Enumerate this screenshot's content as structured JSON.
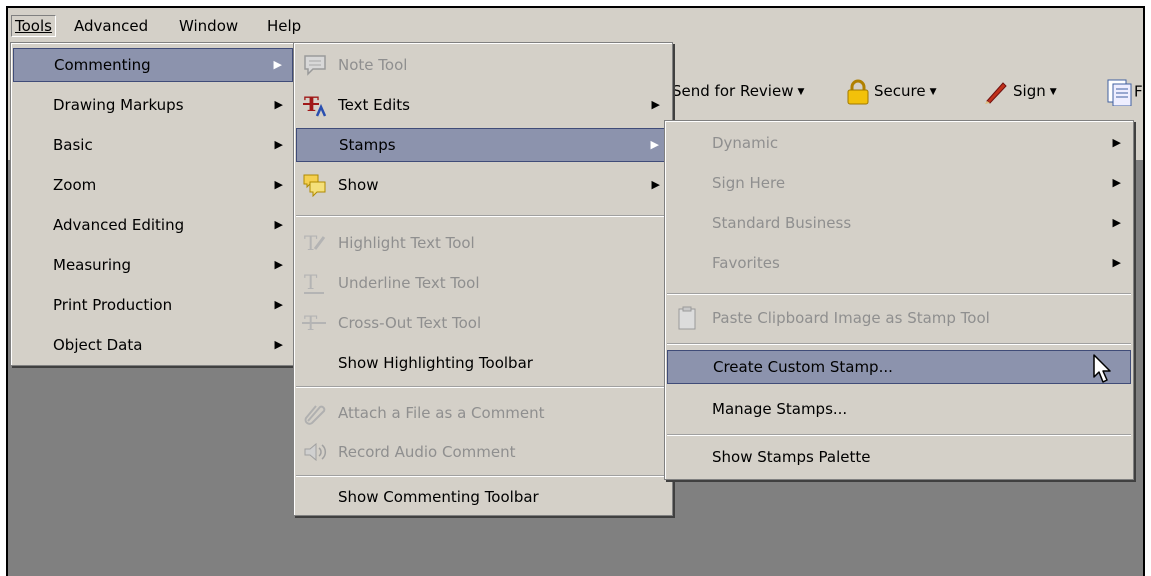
{
  "menubar": {
    "items": [
      {
        "label": "Tools",
        "open": true
      },
      {
        "label": "Advanced"
      },
      {
        "label": "Window"
      },
      {
        "label": "Help"
      }
    ]
  },
  "toolbar": {
    "send_for_review": "Send for Review",
    "secure": "Secure",
    "sign": "Sign",
    "forms_partial": "Fo"
  },
  "tools_menu": {
    "items": [
      {
        "label": "Commenting",
        "submenu": true,
        "highlighted": true
      },
      {
        "label": "Drawing Markups",
        "submenu": true
      },
      {
        "label": "Basic",
        "submenu": true
      },
      {
        "label": "Zoom",
        "submenu": true
      },
      {
        "label": "Advanced Editing",
        "submenu": true
      },
      {
        "label": "Measuring",
        "submenu": true
      },
      {
        "label": "Print Production",
        "submenu": true
      },
      {
        "label": "Object Data",
        "submenu": true
      }
    ]
  },
  "commenting_menu": {
    "items": [
      {
        "label": "Note Tool",
        "disabled": true,
        "icon": "note-icon"
      },
      {
        "label": "Text Edits",
        "submenu": true,
        "icon": "text-edits-icon"
      },
      {
        "label": "Stamps",
        "submenu": true,
        "highlighted": true
      },
      {
        "label": "Show",
        "submenu": true,
        "icon": "show-comments-icon"
      },
      {
        "label": "Highlight Text Tool",
        "disabled": true,
        "icon": "highlight-icon"
      },
      {
        "label": "Underline Text Tool",
        "disabled": true,
        "icon": "underline-icon"
      },
      {
        "label": "Cross-Out Text Tool",
        "disabled": true,
        "icon": "cross-out-icon"
      },
      {
        "label": "Show Highlighting Toolbar"
      },
      {
        "label": "Attach a File as a Comment",
        "disabled": true,
        "icon": "paperclip-icon"
      },
      {
        "label": "Record Audio Comment",
        "disabled": true,
        "icon": "speaker-icon"
      },
      {
        "label": "Show Commenting Toolbar"
      }
    ]
  },
  "stamps_menu": {
    "items": [
      {
        "label": "Dynamic",
        "submenu": true,
        "disabled": true
      },
      {
        "label": "Sign Here",
        "submenu": true,
        "disabled": true
      },
      {
        "label": "Standard Business",
        "submenu": true,
        "disabled": true
      },
      {
        "label": "Favorites",
        "submenu": true,
        "disabled": true
      },
      {
        "label": "Paste Clipboard Image as Stamp Tool",
        "disabled": true,
        "icon": "clipboard-icon"
      },
      {
        "label": "Create Custom Stamp...",
        "highlighted": true
      },
      {
        "label": "Manage Stamps..."
      },
      {
        "label": "Show Stamps Palette"
      }
    ]
  }
}
